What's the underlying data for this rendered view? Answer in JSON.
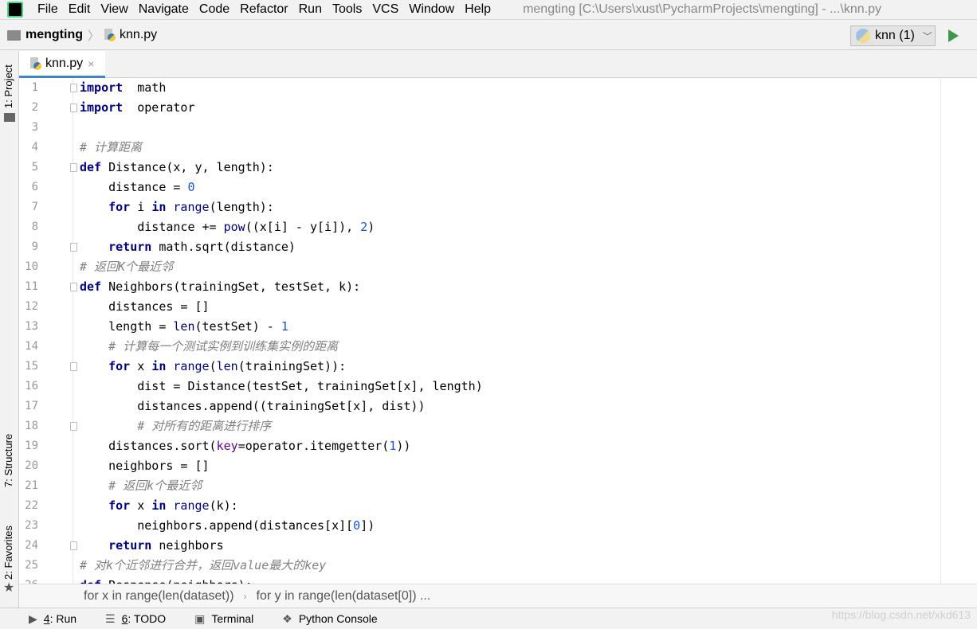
{
  "menubar": {
    "items": [
      "File",
      "Edit",
      "View",
      "Navigate",
      "Code",
      "Refactor",
      "Run",
      "Tools",
      "VCS",
      "Window",
      "Help"
    ],
    "window_title": "mengting [C:\\Users\\xust\\PycharmProjects\\mengting] - ...\\knn.py",
    "logo": "PC"
  },
  "navbar": {
    "project": "mengting",
    "file": "knn.py",
    "run_config": "knn (1)"
  },
  "side_tabs": {
    "project": "1: Project",
    "structure": "7: Structure",
    "favorites": "2: Favorites"
  },
  "tab": {
    "label": "knn.py",
    "close": "×"
  },
  "code_lines": [
    [
      [
        "kw",
        "import"
      ],
      [
        "",
        "  math"
      ]
    ],
    [
      [
        "kw",
        "import"
      ],
      [
        "",
        "  operator"
      ]
    ],
    [],
    [
      [
        "cm",
        "# 计算距离"
      ]
    ],
    [
      [
        "kw",
        "def"
      ],
      [
        "",
        " Distance(x, y, length):"
      ]
    ],
    [
      [
        "",
        "    distance = "
      ],
      [
        "num",
        "0"
      ]
    ],
    [
      [
        "",
        "    "
      ],
      [
        "kw",
        "for"
      ],
      [
        "",
        " i "
      ],
      [
        "kw",
        "in"
      ],
      [
        "",
        " "
      ],
      [
        "bi",
        "range"
      ],
      [
        "",
        "(length):"
      ]
    ],
    [
      [
        "",
        "        distance += "
      ],
      [
        "bi",
        "pow"
      ],
      [
        "",
        "((x[i] - y[i]), "
      ],
      [
        "num",
        "2"
      ],
      [
        "",
        ")"
      ]
    ],
    [
      [
        "",
        "    "
      ],
      [
        "kw",
        "return"
      ],
      [
        "",
        " math.sqrt(distance)"
      ]
    ],
    [
      [
        "cm",
        "# 返回K个最近邻"
      ]
    ],
    [
      [
        "kw",
        "def"
      ],
      [
        "",
        " Neighbors(trainingSet, testSet, k):"
      ]
    ],
    [
      [
        "",
        "    distances = []"
      ]
    ],
    [
      [
        "",
        "    length = "
      ],
      [
        "bi",
        "len"
      ],
      [
        "",
        "(testSet) - "
      ],
      [
        "num",
        "1"
      ]
    ],
    [
      [
        "cm",
        "    # 计算每一个测试实例到训练集实例的距离"
      ]
    ],
    [
      [
        "",
        "    "
      ],
      [
        "kw",
        "for"
      ],
      [
        "",
        " x "
      ],
      [
        "kw",
        "in"
      ],
      [
        "",
        " "
      ],
      [
        "bi",
        "range"
      ],
      [
        "",
        "("
      ],
      [
        "bi",
        "len"
      ],
      [
        "",
        "(trainingSet)):"
      ]
    ],
    [
      [
        "",
        "        dist = Distance(testSet, trainingSet[x], length)"
      ]
    ],
    [
      [
        "",
        "        distances.append((trainingSet[x], dist))"
      ]
    ],
    [
      [
        "cm",
        "        # 对所有的距离进行排序"
      ]
    ],
    [
      [
        "",
        "    distances.sort("
      ],
      [
        "pa",
        "key"
      ],
      [
        "",
        "=operator.itemgetter("
      ],
      [
        "num",
        "1"
      ],
      [
        "",
        "))"
      ]
    ],
    [
      [
        "",
        "    neighbors = []"
      ]
    ],
    [
      [
        "cm",
        "    # 返回k个最近邻"
      ]
    ],
    [
      [
        "",
        "    "
      ],
      [
        "kw",
        "for"
      ],
      [
        "",
        " x "
      ],
      [
        "kw",
        "in"
      ],
      [
        "",
        " "
      ],
      [
        "bi",
        "range"
      ],
      [
        "",
        "(k):"
      ]
    ],
    [
      [
        "",
        "        neighbors.append(distances[x]["
      ],
      [
        "num",
        "0"
      ],
      [
        "",
        "])"
      ]
    ],
    [
      [
        "",
        "    "
      ],
      [
        "kw",
        "return"
      ],
      [
        "",
        " neighbors"
      ]
    ],
    [
      [
        "cm",
        "# 对k个近邻进行合并，返回value最大的key"
      ]
    ],
    [
      [
        "kw",
        "def"
      ],
      [
        "",
        " Response(neighbors):"
      ]
    ]
  ],
  "breadcrumbs": [
    "for x in range(len(dataset))",
    "for y in range(len(dataset[0]) ..."
  ],
  "bottom_tools": [
    {
      "key": "4",
      "label": ": Run",
      "icon": "play-icon"
    },
    {
      "key": "6",
      "label": ": TODO",
      "icon": "list-icon"
    },
    {
      "key": "",
      "label": "Terminal",
      "icon": "terminal-icon"
    },
    {
      "key": "",
      "label": "Python Console",
      "icon": "python-icon"
    }
  ],
  "watermark": "https://blog.csdn.net/xkd613",
  "colors": {
    "keyword": "#000080",
    "number": "#1750eb",
    "comment": "#808080",
    "param": "#660099",
    "run": "#3c9a47",
    "tab_accent": "#4083c9"
  }
}
